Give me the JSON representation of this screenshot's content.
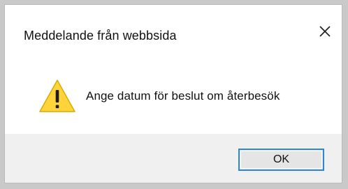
{
  "dialog": {
    "title": "Meddelande från webbsida",
    "message": "Ange datum för beslut om återbesök",
    "ok_label": "OK",
    "close_icon": "close-icon",
    "warning_icon": "warning-icon"
  },
  "colors": {
    "backdrop": "#c9c9c9",
    "dialog_background": "#ffffff",
    "footer_background": "#f0f0f0",
    "button_border": "#2f86d6",
    "warning_yellow": "#ffd43b",
    "text": "#111111"
  }
}
